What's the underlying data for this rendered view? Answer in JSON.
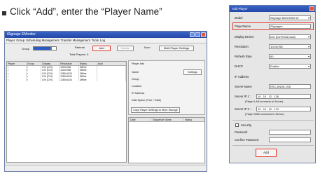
{
  "caption": "Click “Add”, enter the “Player Name”",
  "main_window": {
    "title": "iSignage EMonitor",
    "menu": [
      "Player",
      "Group",
      "Scheduling Management",
      "Transfer Management",
      "Tools",
      "Log"
    ],
    "toolbar": {
      "group_label": "Group",
      "refresh": "Refresh",
      "add": "Add",
      "delete": "Delete",
      "scan": "Scan",
      "multi_player_settings": "Multi Player Settings",
      "total_players": "Total Players: 5"
    },
    "table": {
      "columns": [
        "Player",
        "Group",
        "Display",
        "Resolution",
        "Status",
        "Audi"
      ],
      "rows": [
        [
          "▪",
          "▪",
          "DVI (DVI)",
          "1024x768",
          "Offline",
          ""
        ],
        [
          "▪",
          "▪",
          "DVI (DVI)",
          "1024x768",
          "Offline",
          ""
        ],
        [
          "▪",
          "▪",
          "DVI (DVI)",
          "1280x1024",
          "Offline",
          ""
        ],
        [
          "▪",
          "▪",
          "DVI (DVI)",
          "1280x1024",
          "Offline",
          ""
        ],
        [
          "▪",
          "▪",
          "DVI (DVI)",
          "1280x1024",
          "Offline",
          ""
        ]
      ]
    },
    "player_info": {
      "title": "Player Info",
      "name": "Name",
      "settings": "Settings",
      "group": "Group",
      "location": "Location",
      "ip": "IP Address",
      "disk": "Disk Space (Free / Total)",
      "copy_btn": "Copy Player Settings to More Storage"
    },
    "log_columns": [
      "Date",
      "Sequence Name",
      "Status"
    ]
  },
  "dialog": {
    "title": "Add Player",
    "model_label": "Model",
    "model_value": "iSignage 800x/500A W",
    "player_name_label": "PlayerName",
    "player_name_value": "iSignagex",
    "display_device_label": "Display Device",
    "display_device_value": "DVI (DVI/VGA Dual)",
    "resolution_label": "Resolution",
    "resolution_value": "1024x768",
    "refresh_rate_label": "Refresh Rate",
    "refresh_rate_value": "60",
    "dhcp_label": "DHCP",
    "dhcp_value": "Enable",
    "ip_label": "IP Address",
    "server_name_label": "Server Name",
    "server_name_value": "ESC-ANOIL-SID",
    "server_ip1_label": "Server IP 1 :",
    "server_ip1_value": "10 . 10 . 12 . 126",
    "server_ip1_note": "(Player LAN connects to Server)",
    "server_ip2_label": "Server IP 2 :",
    "server_ip2_value": "10 . 10 . 12 . 170",
    "server_ip2_note": "(Player WAN connects to Server)",
    "security_label": "Security",
    "password_label": "Password",
    "confirm_password_label": "Confirm Password",
    "add_button": "Add"
  },
  "colors": {
    "highlight": "#e2362a",
    "titlebar": "#2a52b8"
  }
}
